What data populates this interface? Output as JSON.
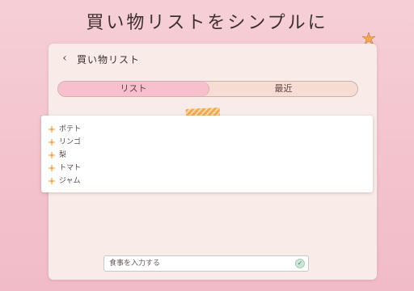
{
  "headline": "買い物リストをシンプルに",
  "header": {
    "back_icon": "chevron-left-icon",
    "title": "買い物リスト"
  },
  "tabs": [
    {
      "label": "リスト",
      "active": true
    },
    {
      "label": "最近",
      "active": false
    }
  ],
  "list": {
    "item_icon": "star-icon",
    "items": [
      {
        "label": "ポテト"
      },
      {
        "label": "リンゴ"
      },
      {
        "label": "梨"
      },
      {
        "label": "トマト"
      },
      {
        "label": "ジャム"
      }
    ]
  },
  "input": {
    "placeholder": "食事を入力する",
    "confirm_icon": "check-icon"
  },
  "colors": {
    "background": "#f3c2cc",
    "card": "#f9ece8",
    "tab_active": "#f8bfcc",
    "tab_inactive": "#f6dcd2",
    "accent": "#f3a64a",
    "confirm": "#cde5d5"
  }
}
